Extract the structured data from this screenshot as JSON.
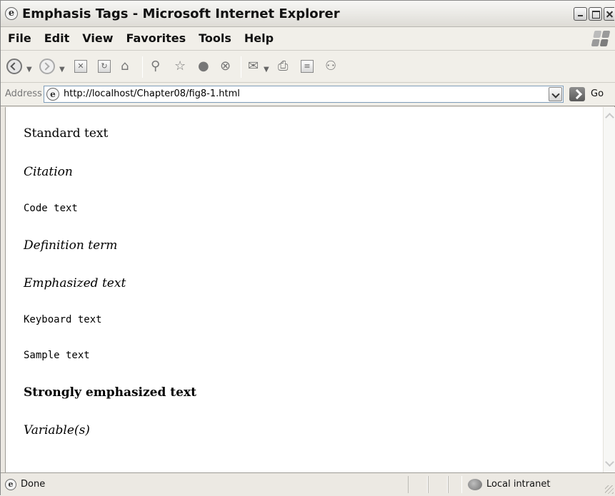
{
  "window": {
    "title": "Emphasis Tags - Microsoft Internet Explorer"
  },
  "menu": {
    "items": [
      "File",
      "Edit",
      "View",
      "Favorites",
      "Tools",
      "Help"
    ]
  },
  "toolbar": {
    "icons": [
      "back-icon",
      "forward-icon",
      "stop-icon",
      "refresh-icon",
      "home-icon",
      "search-icon",
      "favorites-icon",
      "media-icon",
      "history-icon",
      "mail-icon",
      "print-icon",
      "edit-icon",
      "messenger-icon"
    ]
  },
  "address": {
    "label": "Address",
    "url": "http://localhost/Chapter08/fig8-1.html",
    "go_label": "Go"
  },
  "content": {
    "lines": [
      "Standard text",
      "Citation",
      "Code text",
      "Definition term",
      "Emphasized text",
      "Keyboard text",
      "Sample text",
      "Strongly emphasized text",
      "Variable(s)"
    ]
  },
  "status": {
    "text": "Done",
    "zone": "Local intranet"
  },
  "colors": {
    "chrome": "#ece9e3",
    "page_background": "#ffffff",
    "text": "#000000"
  }
}
